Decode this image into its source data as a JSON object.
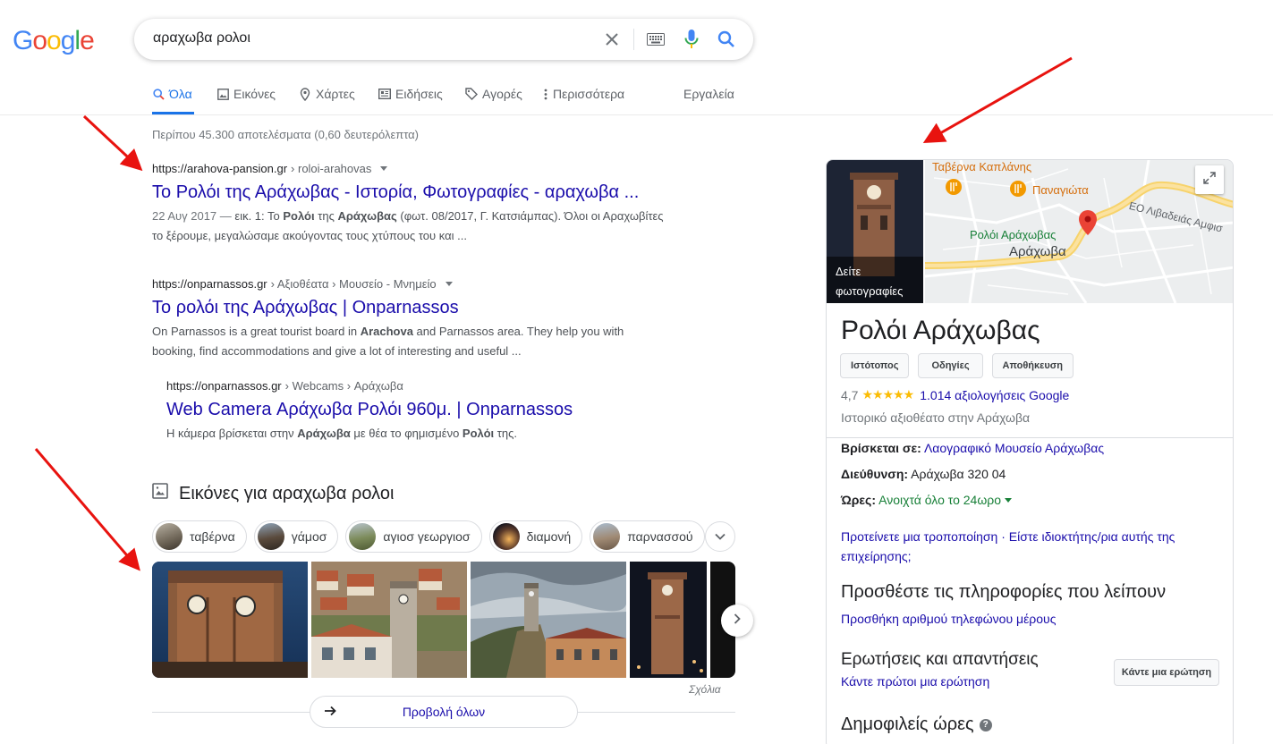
{
  "logo": {
    "text": "Google",
    "letters": [
      "G",
      "o",
      "o",
      "g",
      "l",
      "e"
    ],
    "colors": [
      "#4285f4",
      "#ea4335",
      "#fbbc05",
      "#4285f4",
      "#34a853",
      "#ea4335"
    ]
  },
  "search": {
    "query": "αραχωβα ρολοι"
  },
  "tabs": [
    {
      "label": "Όλα",
      "icon": "search-icon",
      "active": true
    },
    {
      "label": "Εικόνες",
      "icon": "image-icon"
    },
    {
      "label": "Χάρτες",
      "icon": "map-pin-icon"
    },
    {
      "label": "Ειδήσεις",
      "icon": "news-icon"
    },
    {
      "label": "Αγορές",
      "icon": "tag-icon"
    },
    {
      "label": "Περισσότερα",
      "icon": "more-vert-icon"
    }
  ],
  "tools_label": "Εργαλεία",
  "stats": "Περίπου 45.300 αποτελέσματα (0,60 δευτερόλεπτα)",
  "results": [
    {
      "url": "https://arahova-pansion.gr",
      "crumbs": "› roloi-arahovas",
      "title": "Το Ρολόι της Αράχωβας - Ιστορία, Φωτογραφίες - αραχωβα ...",
      "date": "22 Αυγ 2017 —",
      "snippet_1": " εικ. 1: Το ",
      "snippet_b1": "Ρολόι",
      "snippet_2": " της ",
      "snippet_b2": "Αράχωβας",
      "snippet_3": " (φωτ. 08/2017, Γ. Κατσιάμπας). Όλοι οι Αραχωβίτες το ξέρουμε, μεγαλώσαμε ακούγοντας τους χτύπους του και ..."
    },
    {
      "url": "https://onparnassos.gr",
      "crumbs": "› Αξιοθέατα › Μουσείο - Μνημείο",
      "title": "Το ρολόι της Αράχωβας | Onparnassos",
      "snippet_1": "On Parnassos is a great tourist board in ",
      "snippet_b1": "Arachova",
      "snippet_2": " and Parnassos area. They help you with booking, find accommodations and give a lot of interesting and useful ..."
    },
    {
      "url": "https://onparnassos.gr",
      "crumbs": "› Webcams › Αράχωβα",
      "title": "Web Camera Αράχωβα Ρολόι 960μ. | Onparnassos",
      "snippet_1": "Η κάμερα βρίσκεται στην ",
      "snippet_b1": "Αράχωβα",
      "snippet_2": " με θέα το φημισμένο ",
      "snippet_b2": "Ρολόι",
      "snippet_3": " της."
    }
  ],
  "images_section": {
    "heading": "Εικόνες για αραχωβα ρολοι",
    "chips": [
      "ταβέρνα",
      "γάμοσ",
      "αγιοσ γεωργιοσ",
      "διαμονή",
      "παρνασσού"
    ],
    "feedback": "Σχόλια",
    "view_all": "Προβολή όλων"
  },
  "knowledge_panel": {
    "photo_label_1": "Δείτε",
    "photo_label_2": "φωτογραφίες",
    "map_labels": {
      "taverna": "Ταβέρνα Καπλάνης",
      "panagiota": "Παναγιώτα",
      "road": "ΕΟ Λιβαδειάς Αμφισ",
      "place": "Ρολόι Αράχωβας",
      "town": "Αράχωβα"
    },
    "title": "Ρολόι Αράχωβας",
    "buttons": [
      "Ιστότοπος",
      "Οδηγίες",
      "Αποθήκευση"
    ],
    "rating": "4,7",
    "stars": "★★★★★",
    "stars_value": 4.7,
    "reviews": "1.014 αξιολογήσεις Google",
    "category": "Ιστορικό αξιοθέατο στην Αράχωβα",
    "located_label": "Βρίσκεται σε:",
    "located_value": "Λαογραφικό Μουσείο Αράχωβας",
    "address_label": "Διεύθυνση:",
    "address_value": "Αράχωβα 320 04",
    "hours_label": "Ώρες:",
    "hours_value": "Ανοιχτά όλο το 24ωρο",
    "suggest_edit": "Προτείνετε μια τροποποίηση",
    "owner": "Είστε ιδιοκτήτης/ρια αυτής της επιχείρησης;",
    "add_info_heading": "Προσθέστε τις πληροφορίες που λείπουν",
    "add_phone": "Προσθήκη αριθμού τηλεφώνου μέρους",
    "qa_heading": "Ερωτήσεις και απαντήσεις",
    "qa_link": "Κάντε πρώτοι μια ερώτηση",
    "ask_button": "Κάντε μια ερώτηση",
    "popular_heading": "Δημοφιλείς ώρες"
  },
  "annotation_color": "#e8130f"
}
